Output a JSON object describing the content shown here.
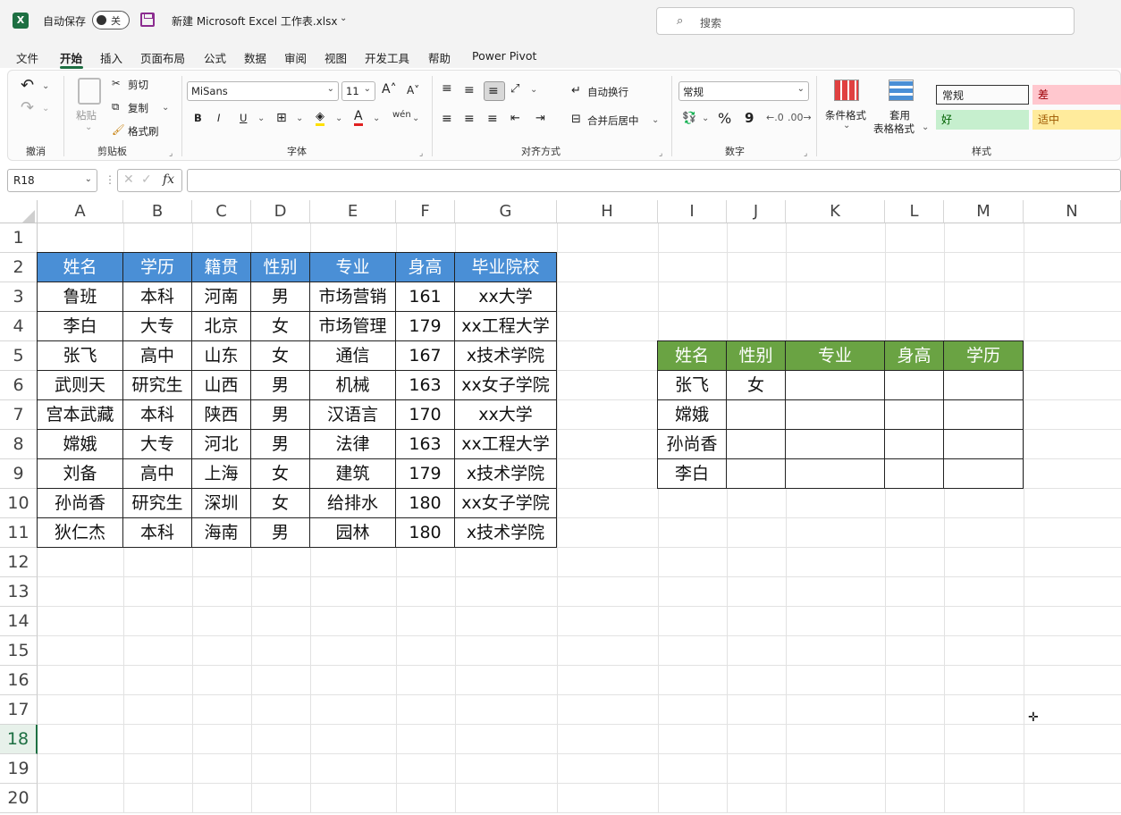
{
  "titlebar": {
    "autosave_label": "自动保存",
    "autosave_state": "关",
    "filename": "新建 Microsoft Excel 工作表.xlsx",
    "search_placeholder": "搜索"
  },
  "menu": {
    "tabs": [
      "文件",
      "开始",
      "插入",
      "页面布局",
      "公式",
      "数据",
      "审阅",
      "视图",
      "开发工具",
      "帮助",
      "Power Pivot"
    ],
    "active": "开始"
  },
  "ribbon": {
    "undo_group": "撤消",
    "clipboard": {
      "paste": "粘贴",
      "cut": "剪切",
      "copy": "复制",
      "format_painter": "格式刷",
      "group": "剪贴板"
    },
    "font": {
      "name": "MiSans",
      "size": "11",
      "group": "字体",
      "bold": "B",
      "italic": "I",
      "underline": "U",
      "phonetic": "wén"
    },
    "alignment": {
      "wrap_text": "自动换行",
      "merge_center": "合并后居中",
      "group": "对齐方式"
    },
    "number": {
      "format": "常规",
      "percent": "%",
      "comma": "9",
      "group": "数字"
    },
    "styles": {
      "conditional": "条件格式",
      "table_format_1": "套用",
      "table_format_2": "表格格式",
      "cells": [
        {
          "label": "常规",
          "bg": "#ffffff",
          "fg": "#222222"
        },
        {
          "label": "差",
          "bg": "#ffc7ce",
          "fg": "#9c0006"
        },
        {
          "label": "好",
          "bg": "#c6efce",
          "fg": "#006100"
        },
        {
          "label": "适中",
          "bg": "#ffeb9c",
          "fg": "#9c5700"
        }
      ],
      "group": "样式"
    }
  },
  "formula_bar": {
    "name_box": "R18",
    "fx": "fx",
    "content": ""
  },
  "grid": {
    "columns": [
      "A",
      "B",
      "C",
      "D",
      "E",
      "F",
      "G",
      "H",
      "I",
      "J",
      "K",
      "L",
      "M",
      "N"
    ],
    "rows": [
      "1",
      "2",
      "3",
      "4",
      "5",
      "6",
      "7",
      "8",
      "9",
      "10",
      "11",
      "12",
      "13",
      "14",
      "15",
      "16",
      "17",
      "18",
      "19",
      "20"
    ],
    "selected_row": "18"
  },
  "table1": {
    "headers": [
      "姓名",
      "学历",
      "籍贯",
      "性别",
      "专业",
      "身高",
      "毕业院校"
    ],
    "rows": [
      [
        "鲁班",
        "本科",
        "河南",
        "男",
        "市场营销",
        "161",
        "xx大学"
      ],
      [
        "李白",
        "大专",
        "北京",
        "女",
        "市场管理",
        "179",
        "xx工程大学"
      ],
      [
        "张飞",
        "高中",
        "山东",
        "女",
        "通信",
        "167",
        "x技术学院"
      ],
      [
        "武则天",
        "研究生",
        "山西",
        "男",
        "机械",
        "163",
        "xx女子学院"
      ],
      [
        "宫本武藏",
        "本科",
        "陕西",
        "男",
        "汉语言",
        "170",
        "xx大学"
      ],
      [
        "嫦娥",
        "大专",
        "河北",
        "男",
        "法律",
        "163",
        "xx工程大学"
      ],
      [
        "刘备",
        "高中",
        "上海",
        "女",
        "建筑",
        "179",
        "x技术学院"
      ],
      [
        "孙尚香",
        "研究生",
        "深圳",
        "女",
        "给排水",
        "180",
        "xx女子学院"
      ],
      [
        "狄仁杰",
        "本科",
        "海南",
        "男",
        "园林",
        "180",
        "x技术学院"
      ]
    ]
  },
  "table2": {
    "headers": [
      "姓名",
      "性别",
      "专业",
      "身高",
      "学历"
    ],
    "rows": [
      [
        "张飞",
        "女",
        "",
        "",
        ""
      ],
      [
        "嫦娥",
        "",
        "",
        "",
        ""
      ],
      [
        "孙尚香",
        "",
        "",
        "",
        ""
      ],
      [
        "李白",
        "",
        "",
        "",
        ""
      ]
    ]
  }
}
